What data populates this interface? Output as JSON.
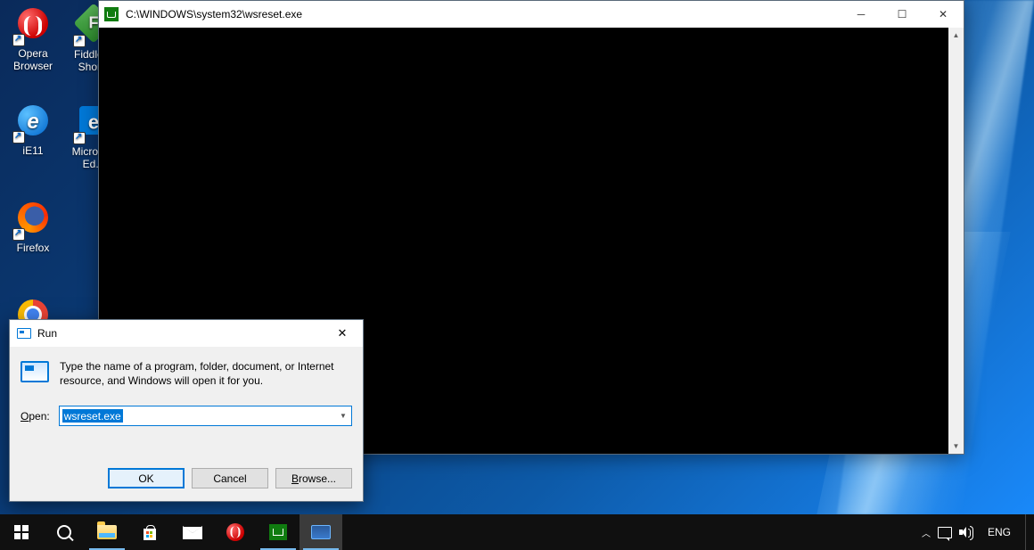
{
  "desktop": {
    "icons": [
      {
        "label": "Opera Browser"
      },
      {
        "label": "Fiddler - Shor..."
      },
      {
        "label": "iE11"
      },
      {
        "label": "Microsoft Ed..."
      },
      {
        "label": "Firefox"
      }
    ]
  },
  "console": {
    "title": "C:\\WINDOWS\\system32\\wsreset.exe"
  },
  "run": {
    "title": "Run",
    "description": "Type the name of a program, folder, document, or Internet resource, and Windows will open it for you.",
    "open_label": "Open:",
    "open_value": "wsreset.exe",
    "ok": "OK",
    "cancel": "Cancel",
    "browse": "Browse..."
  },
  "tray": {
    "lang": "ENG"
  }
}
